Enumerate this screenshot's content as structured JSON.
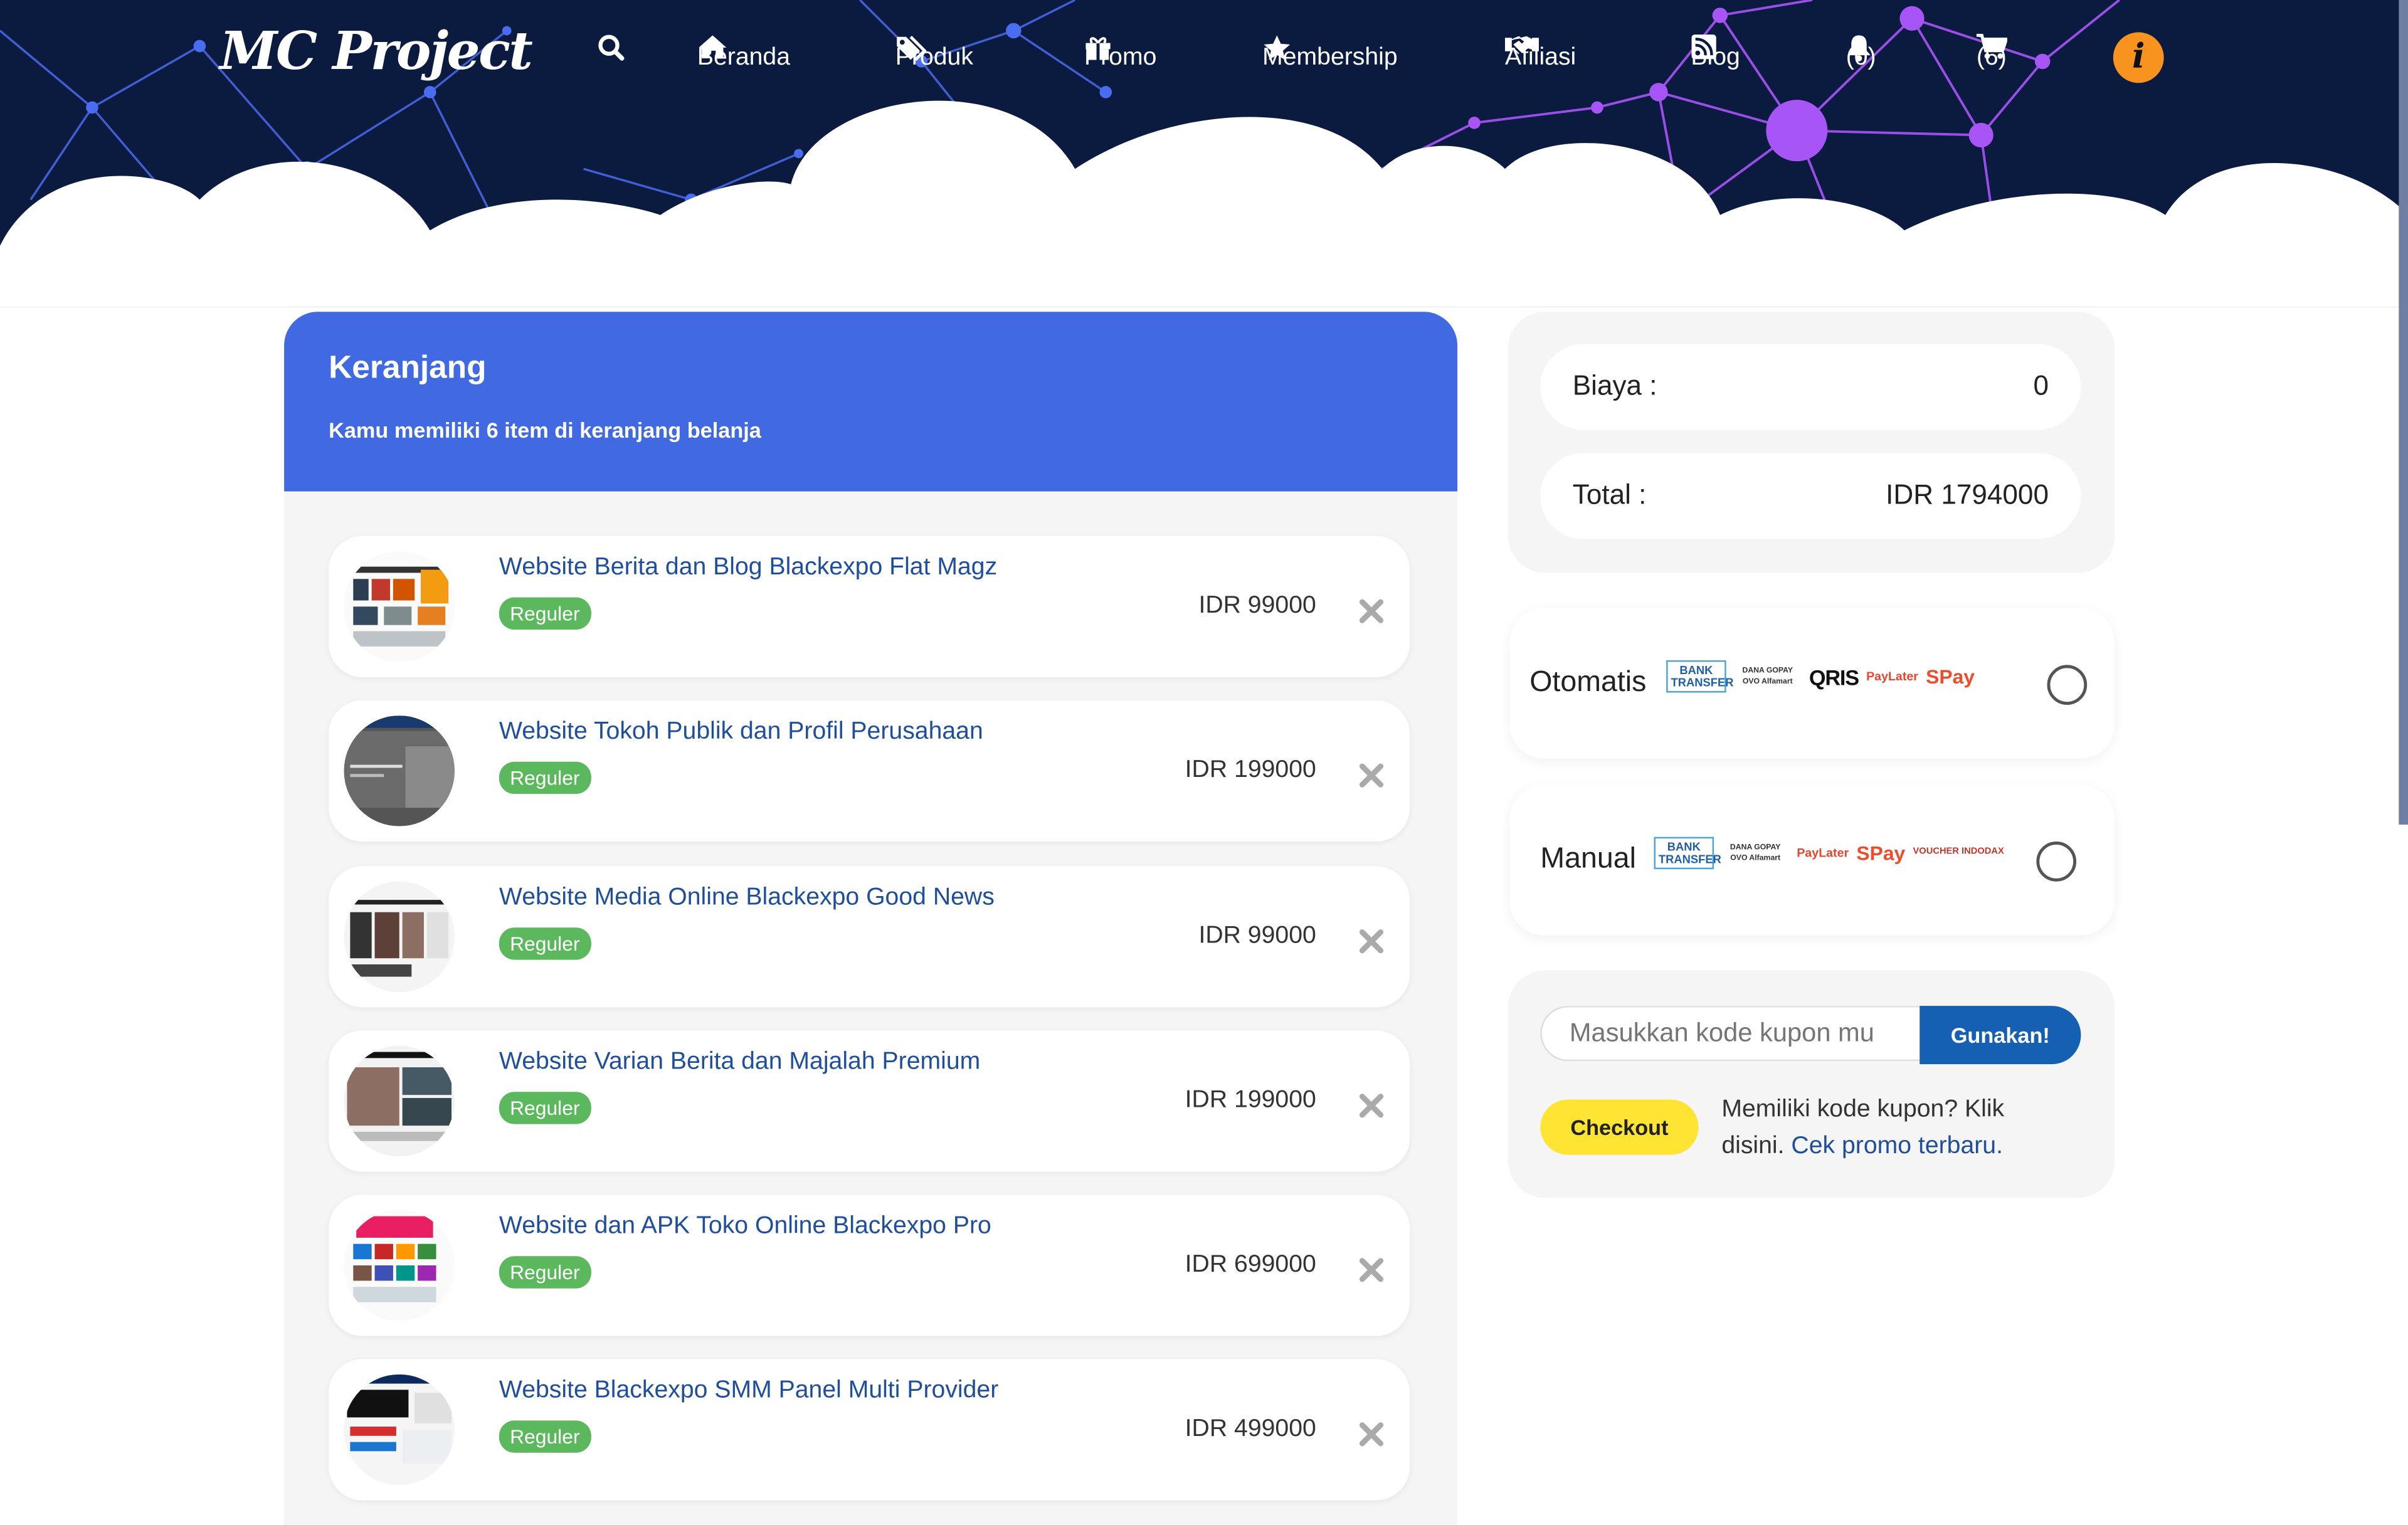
{
  "header": {
    "logo": "MC Project",
    "nav": [
      {
        "label": "Beranda",
        "icon": "home-icon"
      },
      {
        "label": "Produk",
        "icon": "tags-icon"
      },
      {
        "label": "Promo",
        "icon": "gift-icon"
      },
      {
        "label": "Membership",
        "icon": "star-icon"
      },
      {
        "label": "Afiliasi",
        "icon": "handshake-icon"
      },
      {
        "label": "Blog",
        "icon": "rss-icon"
      }
    ],
    "notifications": "(0)",
    "cart_count": "(6)",
    "info": "i",
    "colors": {
      "bg": "#0b1a3f",
      "accent": "#f7931e"
    }
  },
  "cart": {
    "title": "Keranjang",
    "subtitle": "Kamu memiliki 6 item di keranjang belanja",
    "items": [
      {
        "name": "Website Berita dan Blog Blackexpo Flat Magz",
        "badge": "Reguler",
        "price": "IDR 99000"
      },
      {
        "name": "Website Tokoh Publik dan Profil Perusahaan",
        "badge": "Reguler",
        "price": "IDR 199000"
      },
      {
        "name": "Website Media Online Blackexpo Good News",
        "badge": "Reguler",
        "price": "IDR 99000"
      },
      {
        "name": "Website Varian Berita dan Majalah Premium",
        "badge": "Reguler",
        "price": "IDR 199000"
      },
      {
        "name": "Website dan APK Toko Online Blackexpo Pro",
        "badge": "Reguler",
        "price": "IDR 699000"
      },
      {
        "name": "Website Blackexpo SMM Panel Multi Provider",
        "badge": "Reguler",
        "price": "IDR 499000"
      }
    ]
  },
  "summary": {
    "fee_label": "Biaya :",
    "fee_value": "0",
    "total_label": "Total :",
    "total_value": "IDR 1794000"
  },
  "payment": {
    "auto_label": "Otomatis",
    "manual_label": "Manual",
    "logos": {
      "bank": "BANK TRANSFER",
      "ewallet": "DANA GOPAY OVO Alfamart",
      "qris": "QRIS",
      "paylater": "PayLater",
      "spay": "SPay",
      "voucher": "VOUCHER INDODAX"
    }
  },
  "coupon": {
    "placeholder": "Masukkan kode kupon mu",
    "apply_label": "Gunakan!",
    "checkout_label": "Checkout",
    "note": "Memiliki kode kupon? Klik disini.",
    "promo_link": "Cek promo terbaru."
  }
}
